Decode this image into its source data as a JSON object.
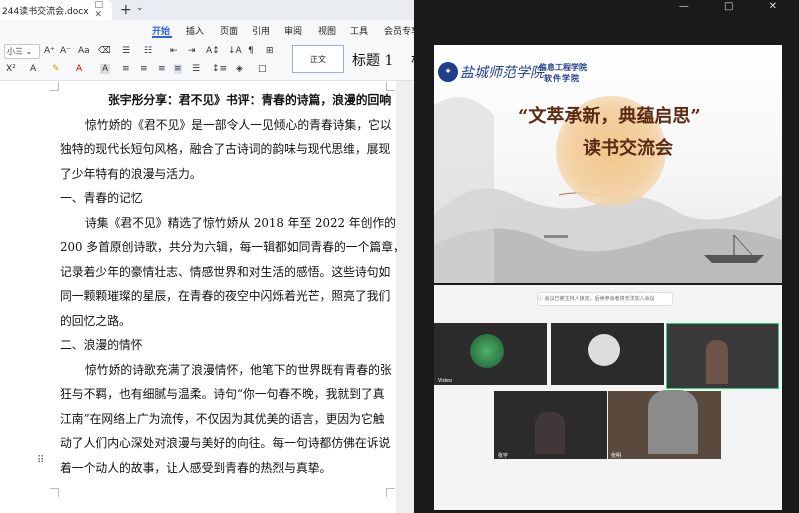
{
  "word": {
    "doc_tab": {
      "name": "244读书交流会.docx",
      "icons": "□ ✕"
    },
    "new_tab": "+",
    "tab_menu": "⌄",
    "ribbon_tabs": [
      {
        "label": "开始",
        "active": true
      },
      {
        "label": "插入",
        "active": false
      },
      {
        "label": "页面",
        "active": false
      },
      {
        "label": "引用",
        "active": false
      },
      {
        "label": "审阅",
        "active": false
      },
      {
        "label": "视图",
        "active": false
      },
      {
        "label": "工具",
        "active": false
      },
      {
        "label": "会员专享",
        "active": false
      }
    ],
    "font_size": "小三",
    "styles": {
      "normal": "正文",
      "heading1": "标题 1",
      "next": "标"
    },
    "document": {
      "lines": [
        "张宇彤分享：君不见》书评：青春的诗篇，浪漫的回响",
        "惊竹娇的《君不见》是一部令人一见倾心的青春诗集，它以",
        "独特的现代长短句风格，融合了古诗词的韵味与现代思维，展现",
        "了少年特有的浪漫与活力。",
        "一、青春的记忆",
        "诗集《君不见》精选了惊竹娇从 2018 年至 2022 年创作的",
        "200 多首原创诗歌，共分为六辑，每一辑都如同青春的一个篇章，",
        "记录着少年的豪情壮志、情感世界和对生活的感悟。这些诗句如",
        "同一颗颗璀璨的星辰，在青春的夜空中闪烁着光芒，照亮了我们",
        "的回忆之路。",
        "二、浪漫的情怀",
        "惊竹娇的诗歌充满了浪漫情怀，他笔下的世界既有青春的张",
        "狂与不羁，也有细腻与温柔。诗句“你一句春不晚，我就到了真",
        "江南”在网络上广为流传，不仅因为其优美的语言，更因为它触",
        "动了人们内心深处对浪漫与美好的向往。每一句诗都仿佛在诉说",
        "着一个动人的故事，让人感受到青春的热烈与真挚。"
      ]
    }
  },
  "viewer": {
    "window_controls": "— □ ✕",
    "slide1": {
      "school_name": "盐城师范学院",
      "college_line1": "信息工程学院",
      "college_line2": "软件学院",
      "title": "“文萃承新，典蕴启思”",
      "subtitle": "读书交流会"
    },
    "slide2": {
      "notice": "ⓘ 会议已被主持人锁定，后续参会者将无法加入会议",
      "participant_tags": [
        "Video",
        "张宇",
        "张明"
      ]
    }
  }
}
